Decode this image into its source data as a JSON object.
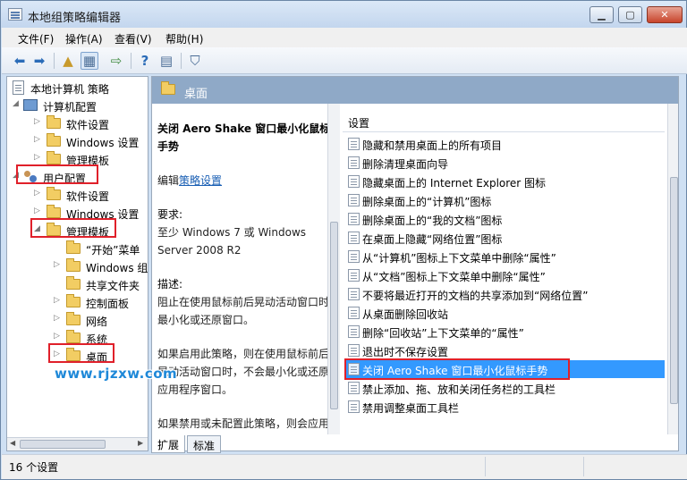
{
  "window": {
    "title": "本地组策略编辑器"
  },
  "menu": [
    "文件(F)",
    "操作(A)",
    "查看(V)",
    "帮助(H)"
  ],
  "tree": {
    "root": "本地计算机 策略",
    "items": [
      {
        "label": "计算机配置"
      },
      {
        "label": "软件设置"
      },
      {
        "label": "Windows 设置"
      },
      {
        "label": "管理模板"
      },
      {
        "label": "用户配置"
      },
      {
        "label": "软件设置"
      },
      {
        "label": "Windows 设置"
      },
      {
        "label": "管理模板"
      },
      {
        "label": "“开始”菜单"
      },
      {
        "label": "Windows 组件"
      },
      {
        "label": "共享文件夹"
      },
      {
        "label": "控制面板"
      },
      {
        "label": "网络"
      },
      {
        "label": "系统"
      },
      {
        "label": "桌面"
      }
    ]
  },
  "right": {
    "header": "桌面",
    "description": {
      "title": "关闭 Aero Shake 窗口最小化鼠标手势",
      "edit_prefix": "编辑",
      "edit_link": "策略设置",
      "requirements_label": "要求:",
      "requirements": "至少 Windows 7 或 Windows Server 2008 R2",
      "desc_label": "描述:",
      "desc": "阻止在使用鼠标前后晃动活动窗口时最小化或还原窗口。",
      "enabled_text": "如果启用此策略，则在使用鼠标前后晃动活动窗口时，不会最小化或还原应用程序窗口。",
      "disabled_text": "如果禁用或未配置此策略，则会应用此窗口最小化或还原手势。"
    },
    "list": {
      "header": "设置",
      "items": [
        "隐藏和禁用桌面上的所有项目",
        "删除清理桌面向导",
        "隐藏桌面上的 Internet Explorer 图标",
        "删除桌面上的“计算机”图标",
        "删除桌面上的“我的文档”图标",
        "在桌面上隐藏“网络位置”图标",
        "从“计算机”图标上下文菜单中删除“属性”",
        "从“文档”图标上下文菜单中删除“属性”",
        "不要将最近打开的文档的共享添加到“网络位置”",
        "从桌面删除回收站",
        "删除“回收站”上下文菜单的“属性”",
        "退出时不保存设置",
        "关闭 Aero Shake 窗口最小化鼠标手势",
        "禁止添加、拖、放和关闭任务栏的工具栏",
        "禁用调整桌面工具栏"
      ],
      "selected_index": 12
    }
  },
  "tabs": [
    "扩展",
    "标准"
  ],
  "status": "16 个设置",
  "watermark": "www.rjzxw.com",
  "colors": {
    "highlight_box": "#e0202a",
    "selection": "#3399ff",
    "header_bg": "#8fa9c7"
  }
}
